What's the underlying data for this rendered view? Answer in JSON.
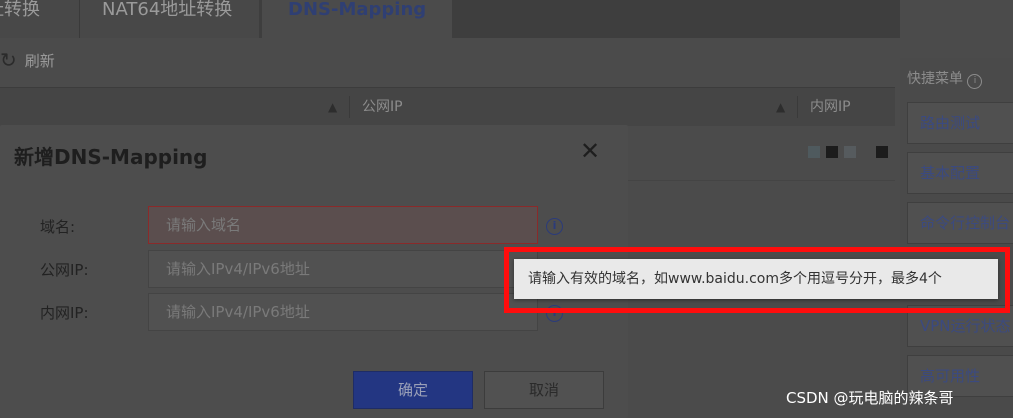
{
  "tabs": [
    {
      "label": "址转换"
    },
    {
      "label": "NAT64地址转换"
    },
    {
      "label": "DNS-Mapping"
    }
  ],
  "toolbar": {
    "refresh_label": "刷新",
    "refresh_icon": "refresh-icon"
  },
  "table": {
    "headers": [
      "公网IP",
      "内网IP"
    ]
  },
  "quick_menu": {
    "title": "快捷菜单",
    "items": [
      "路由测试",
      "基本配置",
      "命令行控制台",
      "VPN运行状态",
      "高可用性"
    ]
  },
  "dialog": {
    "title": "新增DNS-Mapping",
    "fields": [
      {
        "label": "域名:",
        "placeholder": "请输入域名"
      },
      {
        "label": "公网IP:",
        "placeholder": "请输入IPv4/IPv6地址"
      },
      {
        "label": "内网IP:",
        "placeholder": "请输入IPv4/IPv6地址"
      }
    ],
    "ok_label": "确定",
    "cancel_label": "取消"
  },
  "tooltip": {
    "text": "请输入有效的域名，如www.baidu.com多个用逗号分开，最多4个"
  },
  "colors": {
    "highlight": "#ff0d0d",
    "primary": "#233682"
  },
  "watermark": "CSDN @玩电脑的辣条哥"
}
